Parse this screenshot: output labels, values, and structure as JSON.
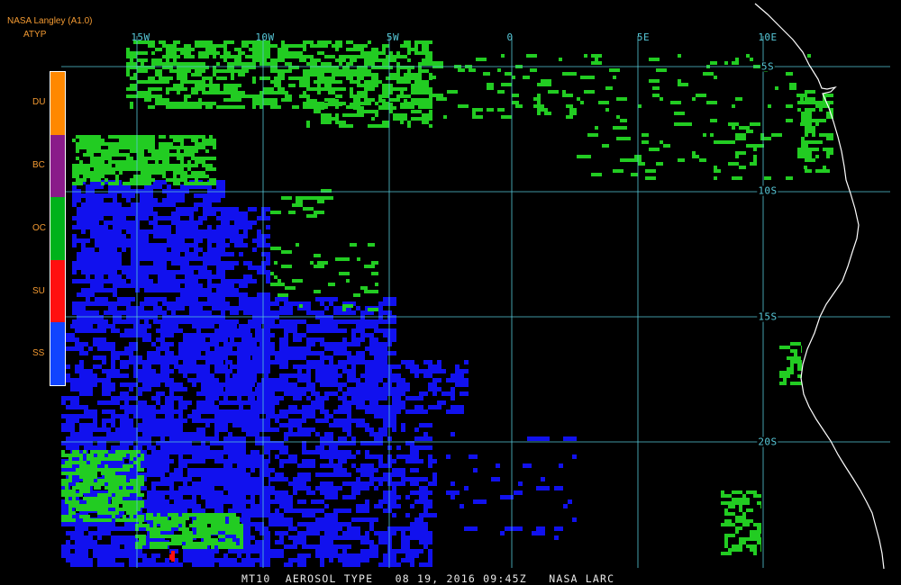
{
  "header": {
    "title": "NASA Langley (A1.0)",
    "product": "ATYP"
  },
  "grid": {
    "longitudes": [
      "15W",
      "10W",
      "5W",
      "0",
      "5E",
      "10E"
    ],
    "latitudes": [
      "5S",
      "10S",
      "15S",
      "20S"
    ]
  },
  "legend": {
    "items": [
      {
        "label": "DU",
        "color": "#ff8800"
      },
      {
        "label": "BC",
        "color": "#8a1b8a"
      },
      {
        "label": "OC",
        "color": "#00b21a"
      },
      {
        "label": "SU",
        "color": "#ff1010"
      },
      {
        "label": "SS",
        "color": "#1144ff"
      }
    ]
  },
  "colors": {
    "grid": "#57c8d8",
    "coast": "#ffffff",
    "ss": "#1111ee",
    "oc": "#22cc22",
    "su": "#ff1010"
  },
  "footer": {
    "text": "MT10  AEROSOL TYPE   08 19, 2016 09:45Z   NASA LARC"
  }
}
